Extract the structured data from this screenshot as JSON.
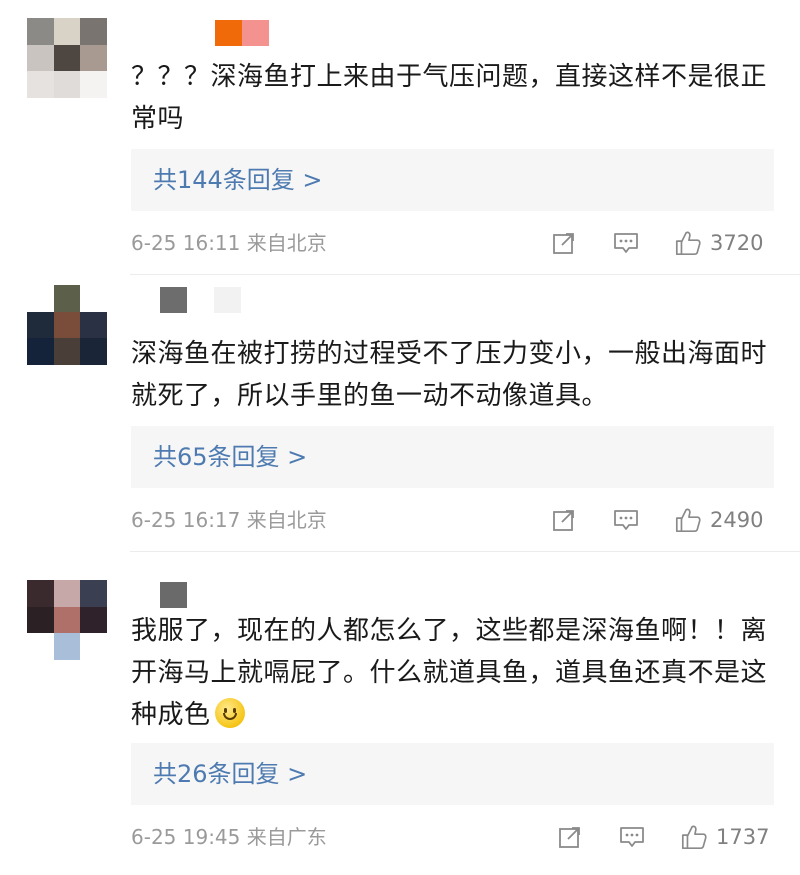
{
  "comments": [
    {
      "text": "？？？深海鱼打上来由于气压问题，直接这样不是很正常吗",
      "replies": "共144条回复 >",
      "meta": "6-25 16:11 来自北京",
      "likes": "3720",
      "avatar_colors": [
        "#8c8a86",
        "#d9d2c6",
        "#7a7470",
        "#c9c4bf",
        "#4e4640",
        "#a89a90",
        "#e6e2e0",
        "#e0dcd9",
        "#f5f3f2"
      ],
      "name_colors": [
        "#f06a0a",
        "#f4928f"
      ]
    },
    {
      "text": "深海鱼在被打捞的过程受不了压力变小，一般出海面时就死了，所以手里的鱼一动不动像道具。",
      "replies": "共65条回复 >",
      "meta": "6-25 16:17 来自北京",
      "likes": "2490",
      "avatar_colors": [
        "#ffffff",
        "#5c5f4a",
        "#ffffff",
        "#1f2a3a",
        "#7a4d3a",
        "#2a3145",
        "#15233a",
        "#4a3e38",
        "#1a2538"
      ],
      "name_colors": [
        "#6d6d6d",
        "#ffffff",
        "#f2f2f2"
      ]
    },
    {
      "text": "我服了，现在的人都怎么了，这些都是深海鱼啊！！离开海马上就嗝屁了。什么就道具鱼，道具鱼还真不是这种成色",
      "replies": "共26条回复 >",
      "meta": "6-25 19:45 来自广东",
      "likes": "1737",
      "avatar_colors": [
        "#3a2a2e",
        "#c6a8a8",
        "#3a3f52",
        "#2b2024",
        "#b0706a",
        "#30222a",
        "#ffffff",
        "#a9bed8",
        "#ffffff"
      ],
      "name_colors": [
        "#ffffff",
        "#6a6a6a",
        "#ffffff"
      ]
    }
  ],
  "icons": {
    "share": "share-icon",
    "comment": "comment-icon",
    "like": "thumbs-up-icon"
  }
}
